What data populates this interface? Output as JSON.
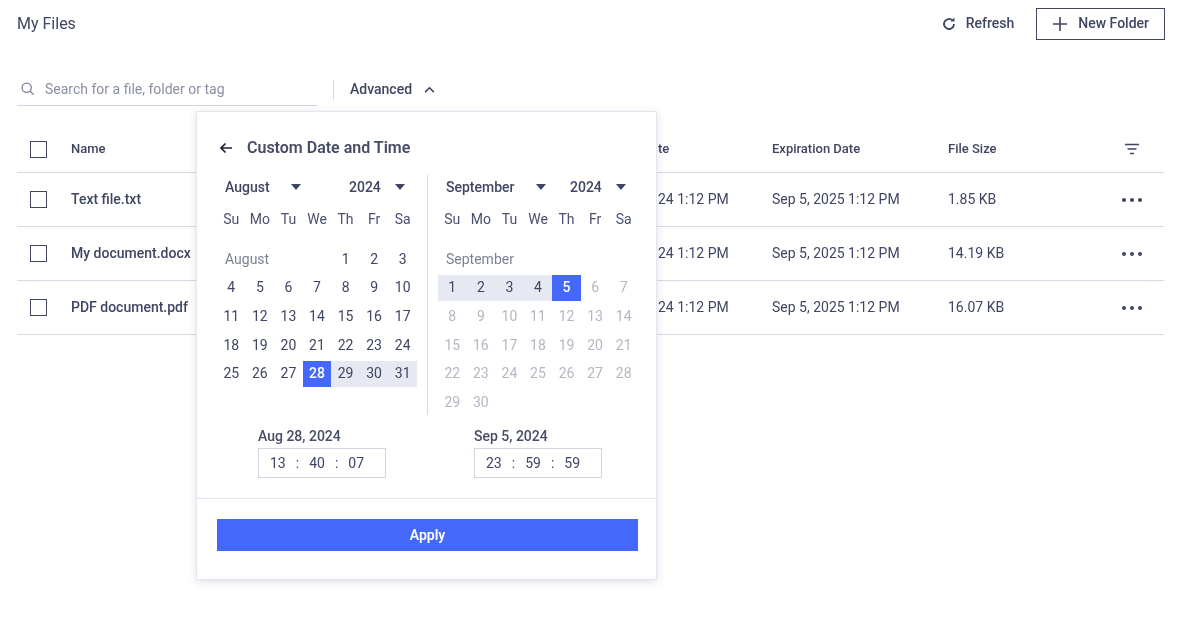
{
  "page_title": "My Files",
  "toolbar": {
    "refresh": "Refresh",
    "new_folder": "New Folder"
  },
  "search": {
    "placeholder": "Search for a file, folder or tag"
  },
  "advanced": {
    "label": "Advanced",
    "expanded": true
  },
  "table": {
    "columns": [
      "Name",
      "te",
      "Expiration Date",
      "File Size"
    ],
    "rows": [
      {
        "checked": false,
        "cells": [
          "Text file.txt",
          "24 1:12 PM",
          "Sep 5, 2025 1:12 PM",
          "1.85 KB"
        ]
      },
      {
        "checked": false,
        "cells": [
          "My document.docx",
          "24 1:12 PM",
          "Sep 5, 2025 1:12 PM",
          "14.19 KB"
        ]
      },
      {
        "checked": false,
        "cells": [
          "PDF document.pdf",
          "24 1:12 PM",
          "Sep 5, 2025 1:12 PM",
          "16.07 KB"
        ]
      }
    ]
  },
  "header_checked": false,
  "date_picker": {
    "title": "Custom Date and Time",
    "calendars": [
      {
        "month": "August",
        "year": "2024",
        "weekdays": [
          "Su",
          "Mo",
          "Tu",
          "We",
          "Th",
          "Fr",
          "Sa"
        ],
        "caption": "August",
        "weeks": [
          {
            "kind": "leading",
            "days": [
              {
                "label": "1",
                "selected": false,
                "in_range": false,
                "disabled": false
              },
              {
                "label": "2",
                "selected": false,
                "in_range": false,
                "disabled": false
              },
              {
                "label": "3",
                "selected": false,
                "in_range": false,
                "disabled": false
              }
            ]
          },
          {
            "days": [
              {
                "label": "4",
                "selected": false,
                "in_range": false,
                "disabled": false
              },
              {
                "label": "5",
                "selected": false,
                "in_range": false,
                "disabled": false
              },
              {
                "label": "6",
                "selected": false,
                "in_range": false,
                "disabled": false
              },
              {
                "label": "7",
                "selected": false,
                "in_range": false,
                "disabled": false
              },
              {
                "label": "8",
                "selected": false,
                "in_range": false,
                "disabled": false
              },
              {
                "label": "9",
                "selected": false,
                "in_range": false,
                "disabled": false
              },
              {
                "label": "10",
                "selected": false,
                "in_range": false,
                "disabled": false
              }
            ]
          },
          {
            "days": [
              {
                "label": "11",
                "selected": false,
                "in_range": false,
                "disabled": false
              },
              {
                "label": "12",
                "selected": false,
                "in_range": false,
                "disabled": false
              },
              {
                "label": "13",
                "selected": false,
                "in_range": false,
                "disabled": false
              },
              {
                "label": "14",
                "selected": false,
                "in_range": false,
                "disabled": false
              },
              {
                "label": "15",
                "selected": false,
                "in_range": false,
                "disabled": false
              },
              {
                "label": "16",
                "selected": false,
                "in_range": false,
                "disabled": false
              },
              {
                "label": "17",
                "selected": false,
                "in_range": false,
                "disabled": false
              }
            ]
          },
          {
            "days": [
              {
                "label": "18",
                "selected": false,
                "in_range": false,
                "disabled": false
              },
              {
                "label": "19",
                "selected": false,
                "in_range": false,
                "disabled": false
              },
              {
                "label": "20",
                "selected": false,
                "in_range": false,
                "disabled": false
              },
              {
                "label": "21",
                "selected": false,
                "in_range": false,
                "disabled": false
              },
              {
                "label": "22",
                "selected": false,
                "in_range": false,
                "disabled": false
              },
              {
                "label": "23",
                "selected": false,
                "in_range": false,
                "disabled": false
              },
              {
                "label": "24",
                "selected": false,
                "in_range": false,
                "disabled": false
              }
            ]
          },
          {
            "days": [
              {
                "label": "25",
                "selected": false,
                "in_range": false,
                "disabled": false
              },
              {
                "label": "26",
                "selected": false,
                "in_range": false,
                "disabled": false
              },
              {
                "label": "27",
                "selected": false,
                "in_range": false,
                "disabled": false
              },
              {
                "label": "28",
                "selected": true,
                "in_range": false,
                "disabled": false
              },
              {
                "label": "29",
                "selected": false,
                "in_range": true,
                "disabled": false
              },
              {
                "label": "30",
                "selected": false,
                "in_range": true,
                "disabled": false
              },
              {
                "label": "31",
                "selected": false,
                "in_range": true,
                "disabled": false
              }
            ]
          }
        ]
      },
      {
        "month": "September",
        "year": "2024",
        "weekdays": [
          "Su",
          "Mo",
          "Tu",
          "We",
          "Th",
          "Fr",
          "Sa"
        ],
        "caption": "September",
        "weeks": [
          {
            "days": [
              {
                "label": "1",
                "selected": false,
                "in_range": true,
                "disabled": false
              },
              {
                "label": "2",
                "selected": false,
                "in_range": true,
                "disabled": false
              },
              {
                "label": "3",
                "selected": false,
                "in_range": true,
                "disabled": false
              },
              {
                "label": "4",
                "selected": false,
                "in_range": true,
                "disabled": false
              },
              {
                "label": "5",
                "selected": true,
                "in_range": false,
                "disabled": false
              },
              {
                "label": "6",
                "selected": false,
                "in_range": false,
                "disabled": true
              },
              {
                "label": "7",
                "selected": false,
                "in_range": false,
                "disabled": true
              }
            ]
          },
          {
            "days": [
              {
                "label": "8",
                "selected": false,
                "in_range": false,
                "disabled": true
              },
              {
                "label": "9",
                "selected": false,
                "in_range": false,
                "disabled": true
              },
              {
                "label": "10",
                "selected": false,
                "in_range": false,
                "disabled": true
              },
              {
                "label": "11",
                "selected": false,
                "in_range": false,
                "disabled": true
              },
              {
                "label": "12",
                "selected": false,
                "in_range": false,
                "disabled": true
              },
              {
                "label": "13",
                "selected": false,
                "in_range": false,
                "disabled": true
              },
              {
                "label": "14",
                "selected": false,
                "in_range": false,
                "disabled": true
              }
            ]
          },
          {
            "days": [
              {
                "label": "15",
                "selected": false,
                "in_range": false,
                "disabled": true
              },
              {
                "label": "16",
                "selected": false,
                "in_range": false,
                "disabled": true
              },
              {
                "label": "17",
                "selected": false,
                "in_range": false,
                "disabled": true
              },
              {
                "label": "18",
                "selected": false,
                "in_range": false,
                "disabled": true
              },
              {
                "label": "19",
                "selected": false,
                "in_range": false,
                "disabled": true
              },
              {
                "label": "20",
                "selected": false,
                "in_range": false,
                "disabled": true
              },
              {
                "label": "21",
                "selected": false,
                "in_range": false,
                "disabled": true
              }
            ]
          },
          {
            "days": [
              {
                "label": "22",
                "selected": false,
                "in_range": false,
                "disabled": true
              },
              {
                "label": "23",
                "selected": false,
                "in_range": false,
                "disabled": true
              },
              {
                "label": "24",
                "selected": false,
                "in_range": false,
                "disabled": true
              },
              {
                "label": "25",
                "selected": false,
                "in_range": false,
                "disabled": true
              },
              {
                "label": "26",
                "selected": false,
                "in_range": false,
                "disabled": true
              },
              {
                "label": "27",
                "selected": false,
                "in_range": false,
                "disabled": true
              },
              {
                "label": "28",
                "selected": false,
                "in_range": false,
                "disabled": true
              }
            ]
          },
          {
            "days": [
              {
                "label": "29",
                "selected": false,
                "in_range": false,
                "disabled": true
              },
              {
                "label": "30",
                "selected": false,
                "in_range": false,
                "disabled": true
              }
            ]
          }
        ]
      }
    ],
    "times": [
      {
        "date": "Aug 28, 2024",
        "hours": "13",
        "minutes": "40",
        "seconds": "07"
      },
      {
        "date": "Sep 5, 2024",
        "hours": "23",
        "minutes": "59",
        "seconds": "59"
      }
    ],
    "separator": ":",
    "apply": "Apply"
  }
}
